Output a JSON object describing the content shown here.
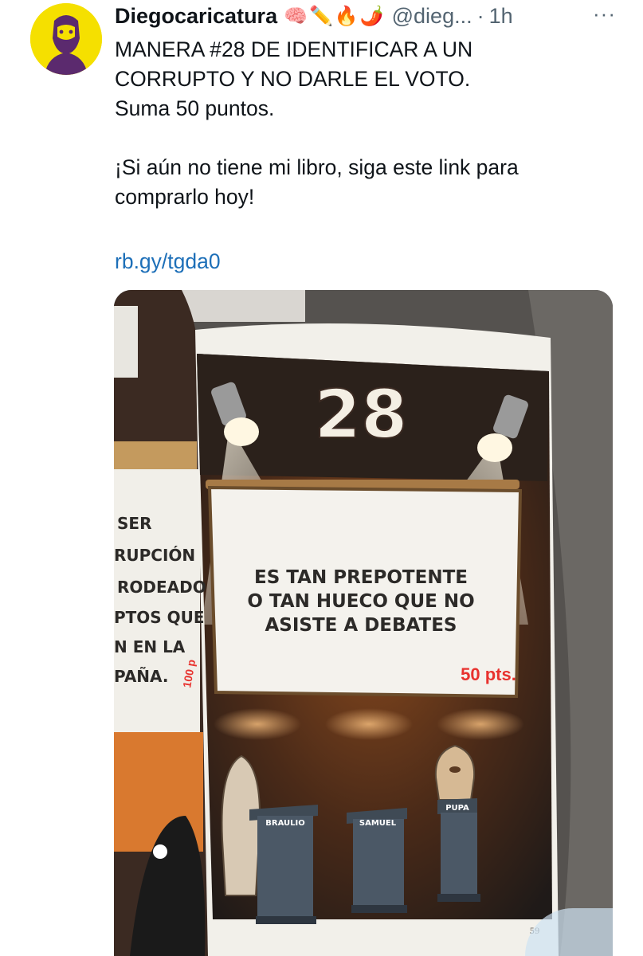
{
  "tweet": {
    "display_name": "Diegocaricatura",
    "emojis": "🧠✏️🔥🌶️",
    "handle": "@dieg...",
    "separator": "·",
    "time": "1h",
    "more": "···",
    "lines": [
      "MANERA #28 DE IDENTIFICAR A UN",
      "CORRUPTO Y NO DARLE EL VOTO.",
      "Suma 50 puntos.",
      "",
      "¡Si aún no tiene mi libro, siga este link para",
      "comprarlo hoy!"
    ],
    "link": "rb.gy/tgda0"
  },
  "book": {
    "number": "28",
    "text_line1": "ES TAN PREPOTENTE",
    "text_line2": "O TAN HUECO QUE NO",
    "text_line3": "ASISTE A DEBATES",
    "points": "50 pts.",
    "podium1": "BRAULIO",
    "podium2": "SAMUEL",
    "podium3": "PUPA",
    "page_number": "59",
    "left_lines": [
      "SER",
      "RUPCIÓN",
      "RODEADO",
      "PTOS QUE",
      "N EN LA",
      "PAÑA."
    ],
    "left_points": "100 p"
  },
  "colors": {
    "link": "#1d6fb8",
    "muted": "#536471",
    "avatar_bg": "#f5e000",
    "points_red": "#e8322e"
  }
}
